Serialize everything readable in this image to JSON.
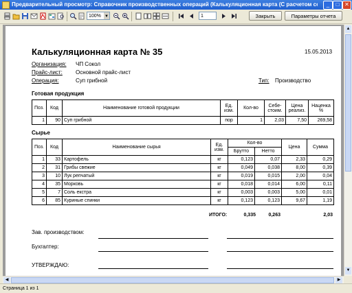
{
  "window": {
    "title": "Предварительный просмотр: Справочник производственных операций (Калькуляционная карта (С расчетом себестоимос..."
  },
  "toolbar": {
    "zoom": "100%",
    "page": "1",
    "close_label": "Закрыть",
    "params_label": "Параметры отчета"
  },
  "doc": {
    "title": "Калькуляционная карта № 35",
    "date": "15.05.2013",
    "org_label": "Организация:",
    "org_value": "ЧП Сокол",
    "price_label": "Прайс-лист:",
    "price_value": "Основной прайс-лист",
    "op_label": "Операция:",
    "op_value": "Суп грибной",
    "type_label": "Тип:",
    "type_value": "Производство",
    "product_section": "Готовая продукция",
    "product_headers": {
      "pos": "Поз.",
      "code": "Код",
      "name": "Наименование готовой продукции",
      "unit1": "Ед.",
      "unit2": "изм.",
      "qty": "Кол-во",
      "cost1": "Себе-",
      "cost2": "стоим.",
      "price1": "Цена",
      "price2": "реализ.",
      "markup1": "Наценка",
      "markup2": "%"
    },
    "product_rows": [
      [
        "1",
        "90",
        "Суп грибной",
        "пор",
        "1",
        "2,03",
        "7,50",
        "269,58"
      ]
    ],
    "raw_section": "Сырье",
    "raw_headers": {
      "pos": "Поз.",
      "code": "Код",
      "name": "Наименование сырья",
      "unit1": "Ед.",
      "unit2": "изм.",
      "qty": "Кол-во",
      "gross": "Брутто",
      "net": "Нетто",
      "price": "Цена",
      "sum": "Сумма"
    },
    "raw_rows": [
      [
        "1",
        "33",
        "Картофель",
        "кг",
        "0,123",
        "0,07",
        "2,33",
        "0,29"
      ],
      [
        "2",
        "31",
        "Грибы свежие",
        "кг",
        "0,049",
        "0,038",
        "8,00",
        "0,39"
      ],
      [
        "3",
        "10",
        "Лук репчатый",
        "кг",
        "0,019",
        "0,015",
        "2,00",
        "0,04"
      ],
      [
        "4",
        "35",
        "Морковь",
        "кг",
        "0,018",
        "0,014",
        "6,00",
        "0,11"
      ],
      [
        "5",
        "7",
        "Соль екстра",
        "кг",
        "0,003",
        "0,003",
        "5,00",
        "0,01"
      ],
      [
        "6",
        "85",
        "Куриные спинки",
        "кг",
        "0,123",
        "0,123",
        "9,67",
        "1,19"
      ]
    ],
    "total_label": "ИТОГО:",
    "total_gross": "0,335",
    "total_net": "0,263",
    "total_sum": "2,03",
    "sign_manager": "Зав. производством:",
    "sign_accountant": "Бухгалтер:",
    "approve": "УТВЕРЖДАЮ:"
  },
  "status": {
    "page_info": "Страница 1 из 1"
  }
}
